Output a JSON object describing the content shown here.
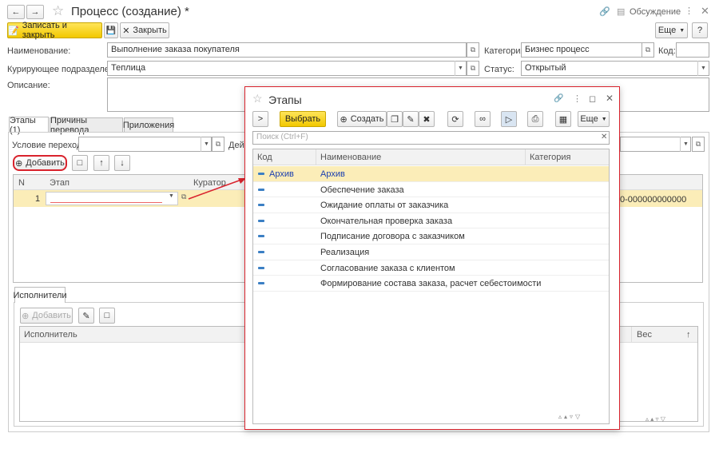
{
  "window": {
    "title": "Процесс (создание) *",
    "discussion": "Обсуждение"
  },
  "toolbar": {
    "save_close": "Записать и закрыть",
    "close": "Закрыть",
    "more": "Еще",
    "help": "?"
  },
  "form": {
    "name_label": "Наименование:",
    "name_value": "Выполнение заказа покупателя",
    "category_label": "Категория:",
    "category_value": "Бизнес процесс",
    "code_label": "Код:",
    "code_value": "",
    "dept_label": "Курирующее подразделение:",
    "dept_value": "Теплица",
    "status_label": "Статус:",
    "status_value": "Открытый",
    "desc_label": "Описание:"
  },
  "tabs": [
    "Этапы (1)",
    "Причины перевода",
    "Приложения"
  ],
  "stages": {
    "condition_label": "Условие перехода:",
    "action_label": "Дейс",
    "add_button": "Добавить",
    "columns": {
      "n": "N",
      "stage": "Этап",
      "curator": "Куратор"
    },
    "row": {
      "n": "1",
      "id_tail": "0-000000000000"
    }
  },
  "executors": {
    "tab": "Исполнители",
    "add_button": "Добавить",
    "col_executor": "Исполнитель",
    "col_weight": "Вес"
  },
  "dialog": {
    "title": "Этапы",
    "select": "Выбрать",
    "create": "Создать",
    "more": "Еще",
    "search_placeholder": "Поиск (Ctrl+F)",
    "columns": {
      "code": "Код",
      "name": "Наименование",
      "category": "Категория"
    },
    "rows": [
      {
        "code": "Архив",
        "name": "Архив"
      },
      {
        "code": "",
        "name": "Обеспечение заказа"
      },
      {
        "code": "",
        "name": "Ожидание оплаты от заказчика"
      },
      {
        "code": "",
        "name": "Окончательная проверка заказа"
      },
      {
        "code": "",
        "name": "Подписание договора с заказчиком"
      },
      {
        "code": "",
        "name": "Реализация"
      },
      {
        "code": "",
        "name": "Согласование заказа с клиентом"
      },
      {
        "code": "",
        "name": "Формирование состава заказа, расчет себестоимости"
      }
    ]
  },
  "colors": {
    "accent_yellow": "#f2c800",
    "highlight_red": "#d9232d",
    "selected_row": "#fbedb8",
    "link_blue": "#1a3fb0"
  }
}
